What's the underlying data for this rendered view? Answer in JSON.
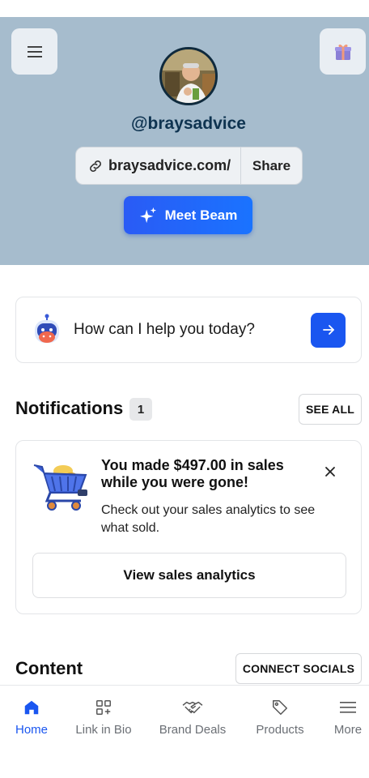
{
  "header": {
    "handle": "@braysadvice",
    "link_text": "braysadvice.com/",
    "share_label": "Share",
    "beam_label": "Meet Beam",
    "bg_color": "#a6bccd"
  },
  "assistant": {
    "prompt": "How can I help you today?"
  },
  "notifications": {
    "title": "Notifications",
    "count": "1",
    "see_all_label": "SEE ALL",
    "card": {
      "title": "You made $497.00 in sales while you were gone!",
      "body": "Check out your sales analytics to see what sold.",
      "button_label": "View sales analytics"
    }
  },
  "content": {
    "title": "Content",
    "connect_label": "CONNECT SOCIALS"
  },
  "bottom_nav": {
    "items": [
      {
        "label": "Home",
        "icon": "home-icon",
        "active": true
      },
      {
        "label": "Link in Bio",
        "icon": "grid-plus-icon",
        "active": false
      },
      {
        "label": "Brand Deals",
        "icon": "handshake-icon",
        "active": false
      },
      {
        "label": "Products",
        "icon": "tag-icon",
        "active": false
      },
      {
        "label": "More",
        "icon": "menu-icon",
        "active": false
      }
    ]
  },
  "colors": {
    "accent": "#1a56f0",
    "header_bg": "#a6bccd",
    "handle": "#0e3350"
  }
}
